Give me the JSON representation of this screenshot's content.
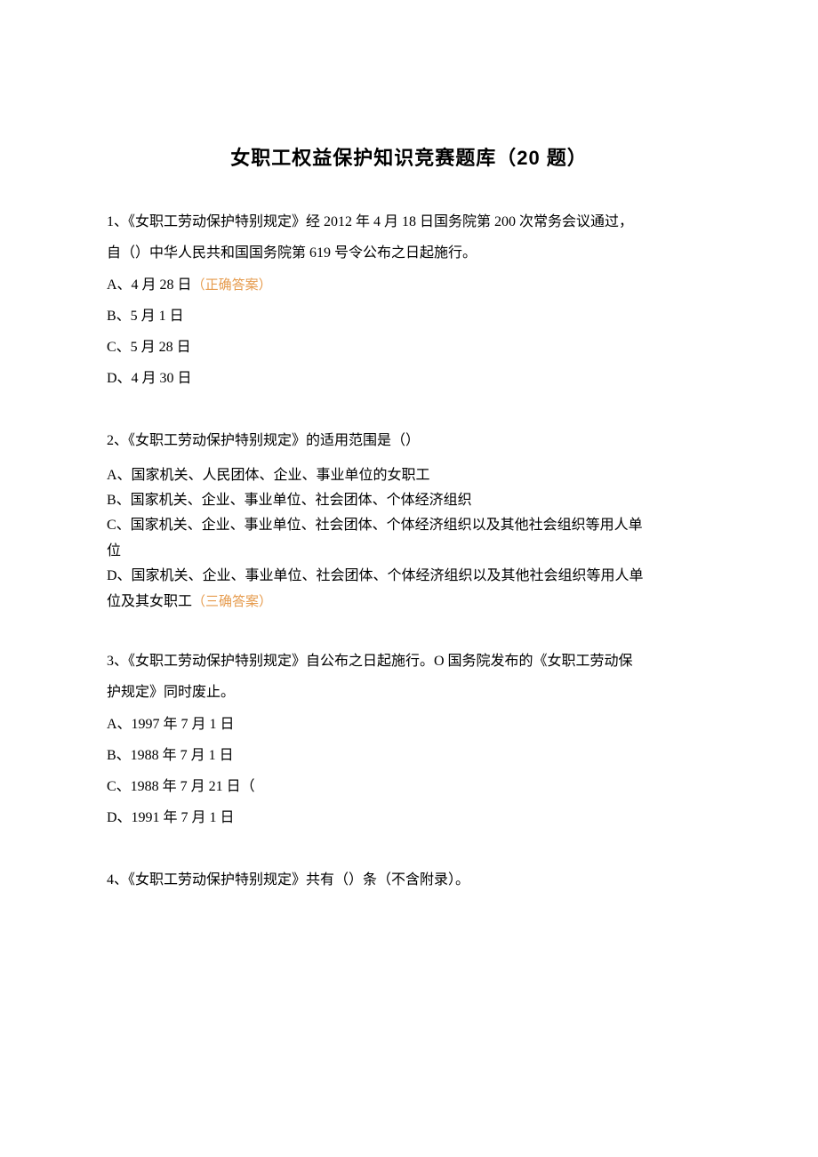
{
  "title_prefix": "女职工权益保护知识竞赛题库（",
  "title_num": "20",
  "title_suffix": " 题）",
  "q1": {
    "text_line1": "1、《女职工劳动保护特别规定》经 2012 年 4 月 18 日国务院第 200 次常务会议通过，",
    "text_line2": "自（）中华人民共和国国务院第 619 号令公布之日起施行。",
    "optA": "A、4 月 28 日",
    "optA_ans": "（正确答案）",
    "optB": "B、5 月 1 日",
    "optC": "C、5 月 28 日",
    "optD": "D、4 月 30 日"
  },
  "q2": {
    "text": "2、《女职工劳动保护特别规定》的适用范围是（）",
    "optA": "A、国家机关、人民团体、企业、事业单位的女职工",
    "optB": "B、国家机关、企业、事业单位、社会团体、个体经济组织",
    "optC_l1": "C、国家机关、企业、事业单位、社会团体、个体经济组织以及其他社会组织等用人单",
    "optC_l2": "位",
    "optD_l1": "D、国家机关、企业、事业单位、社会团体、个体经济组织以及其他社会组织等用人单",
    "optD_l2": "位及其女职工",
    "optD_ans": "（三确答案）"
  },
  "q3": {
    "text_line1": "3、《女职工劳动保护特别规定》自公布之日起施行。O 国务院发布的《女职工劳动保",
    "text_line2": "护规定》同时废止。",
    "optA": "A、1997 年 7 月 1 日",
    "optB": "B、1988 年 7 月 1 日",
    "optC": "C、1988 年 7 月 21 日（",
    "optD": "D、1991 年 7 月 1 日"
  },
  "q4": {
    "text": "4、《女职工劳动保护特别规定》共有（）条（不含附录）。"
  }
}
